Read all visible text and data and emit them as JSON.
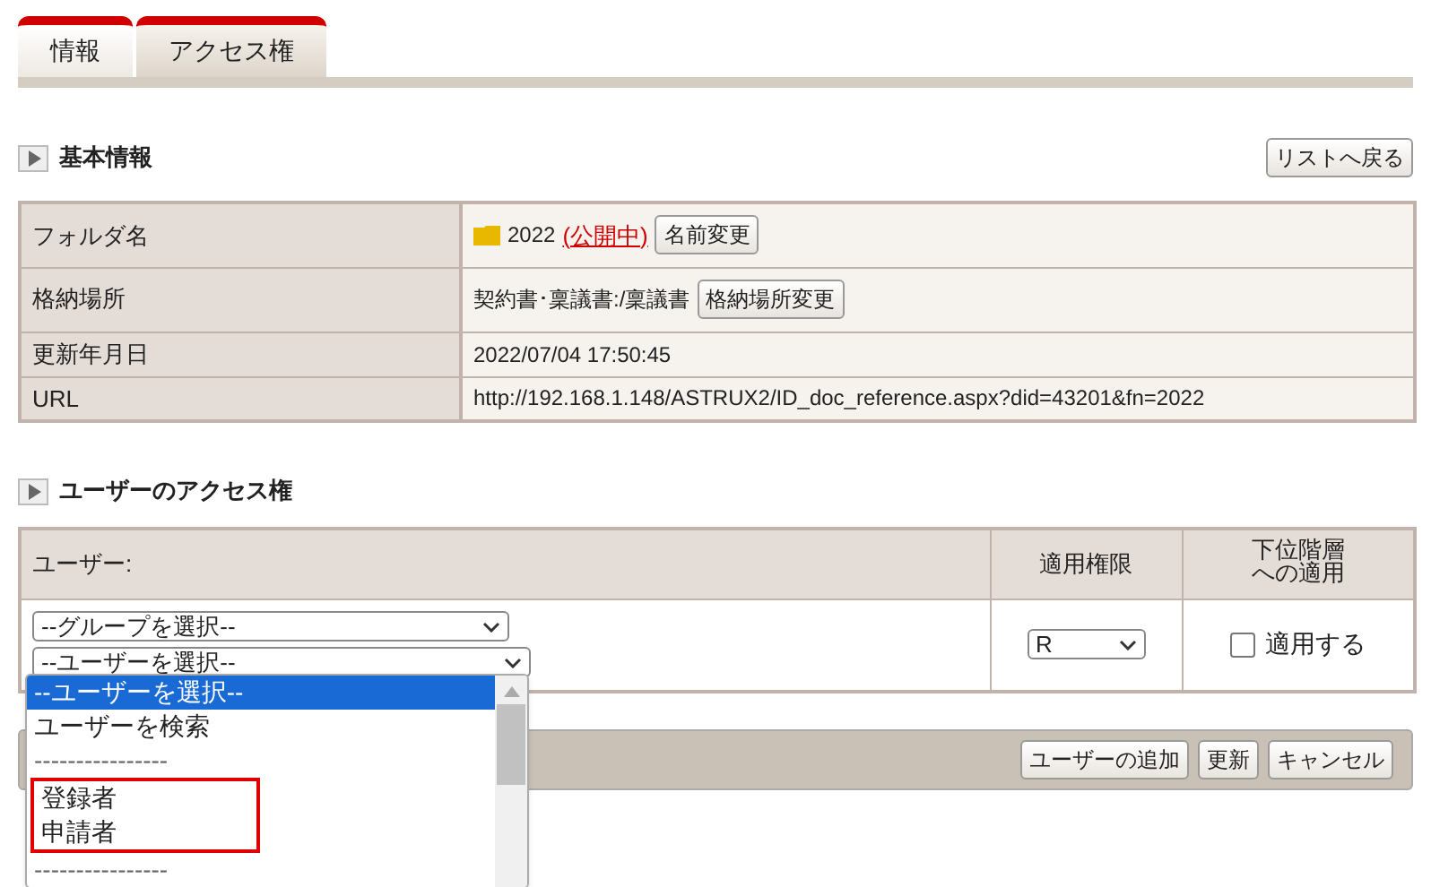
{
  "tabs": [
    {
      "label": "情報",
      "selected": false
    },
    {
      "label": "アクセス権",
      "selected": true
    }
  ],
  "basic_info": {
    "title": "基本情報",
    "back_button": "リストへ戻る",
    "rows": [
      {
        "label": "フォルダ名",
        "value": "2022",
        "status": "(公開中)",
        "button": "名前変更",
        "folder": true
      },
      {
        "label": "格納場所",
        "value": "契約書･稟議書:/稟議書",
        "button": "格納場所変更"
      },
      {
        "label": "更新年月日",
        "value": "2022/07/04 17:50:45"
      },
      {
        "label": "URL",
        "value": "http://192.168.1.148/ASTRUX2/ID_doc_reference.aspx?did=43201&fn=2022"
      }
    ]
  },
  "access": {
    "title": "ユーザーのアクセス権",
    "columns": [
      "ユーザー:",
      "適用権限",
      "下位階層への適用"
    ],
    "group_select": "--グループを選択--",
    "user_select": "--ユーザーを選択--",
    "permission_select": "R",
    "apply_checkbox": {
      "label": "適用する",
      "checked": false
    },
    "buttons": [
      "ユーザーの追加",
      "更新",
      "キャンセル"
    ]
  },
  "user_dropdown": {
    "options": [
      {
        "kind": "option",
        "label": "--ユーザーを選択--",
        "selected": true
      },
      {
        "kind": "option",
        "label": "ユーザーを検索",
        "selected": false
      },
      {
        "kind": "separator",
        "label": "----------------"
      },
      {
        "kind": "highlight",
        "children": [
          {
            "kind": "option",
            "label": "登録者",
            "selected": false
          },
          {
            "kind": "option",
            "label": "申請者",
            "selected": false
          }
        ]
      },
      {
        "kind": "separator",
        "label": "----------------"
      }
    ]
  }
}
